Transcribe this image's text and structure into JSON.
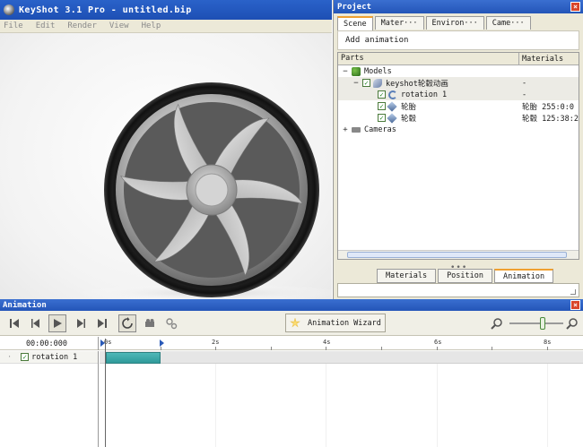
{
  "app": {
    "title": "KeyShot 3.1 Pro  - untitled.bip",
    "menu": [
      "File",
      "Edit",
      "Render",
      "View",
      "Help"
    ]
  },
  "project": {
    "title": "Project",
    "tabs": [
      "Scene",
      "Mater···",
      "Environ···",
      "Came···"
    ],
    "add_animation": "Add animation",
    "columns": {
      "parts": "Parts",
      "materials": "Materials"
    },
    "tree": [
      {
        "label": "Models",
        "material": "",
        "expander": "−"
      },
      {
        "label": "keyshot轮毂动画",
        "material": "-",
        "expander": "−"
      },
      {
        "label": "rotation 1",
        "material": "-",
        "expander": ""
      },
      {
        "label": "轮胎",
        "material": "轮胎 255:0:0",
        "expander": ""
      },
      {
        "label": "轮毂",
        "material": "轮毂 125:38:2",
        "expander": ""
      },
      {
        "label": "Cameras",
        "material": "",
        "expander": "+"
      }
    ],
    "bottom_tabs": [
      "Materials",
      "Position",
      "Animation"
    ],
    "splitter": "•••"
  },
  "animation": {
    "title": "Animation",
    "wizard_label": "Animation Wizard",
    "time_display": "00:00:000",
    "ruler_labels": [
      "0s",
      "2s",
      "4s",
      "6s",
      "8s"
    ],
    "tracks": [
      {
        "label": "rotation 1"
      }
    ],
    "clip": {
      "start_s": 0.0,
      "end_s": 1.0
    }
  },
  "colors": {
    "titlebar": "#2455b8",
    "clip": "#3aa8a8",
    "accent_tab": "#f0a030"
  },
  "icons": {
    "controls": [
      "skip-to-start-icon",
      "step-back-icon",
      "play-icon",
      "step-forward-icon",
      "skip-to-end-icon",
      "loop-icon",
      "camera-icon",
      "settings-icon"
    ],
    "zoom": [
      "zoom-out-icon",
      "zoom-in-icon"
    ]
  }
}
